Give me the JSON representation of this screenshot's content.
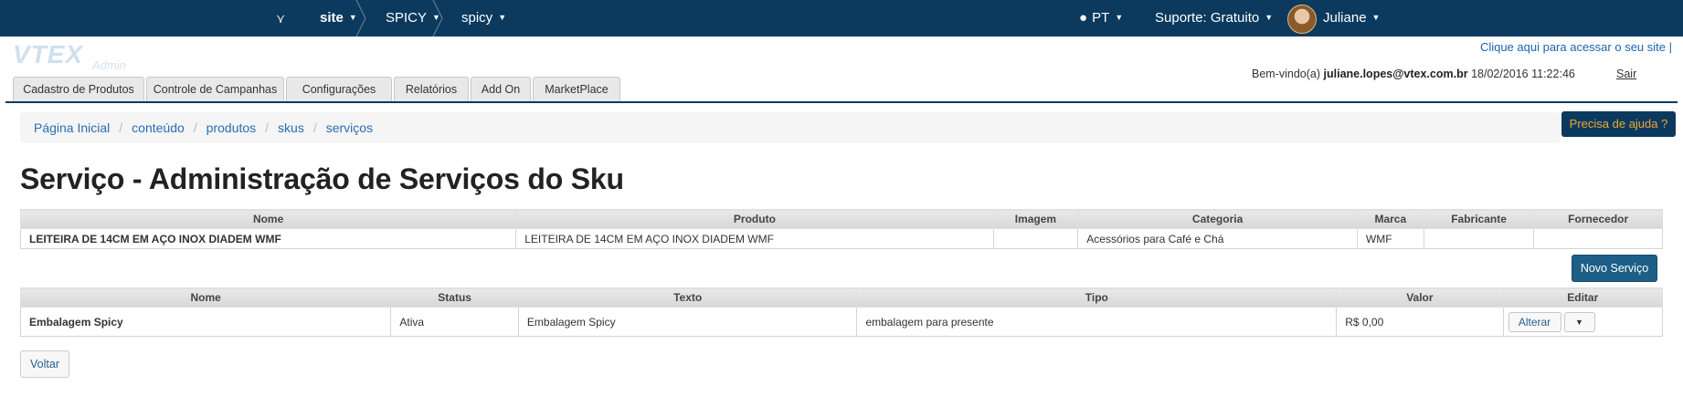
{
  "topbar": {
    "site_label": "site",
    "account_label": "SPICY",
    "store_label": "spicy",
    "language_label": "PT",
    "support_label": "Suporte: Gratuito",
    "user_name": "Juliane"
  },
  "header": {
    "logo_text": "VTEX",
    "logo_sub": "Admin",
    "access_link": "Clique aqui para acessar o seu site |",
    "welcome_prefix": "Bem-vindo(a)",
    "welcome_email": "juliane.lopes@vtex.com.br",
    "welcome_datetime": "18/02/2016 11:22:46",
    "logout_label": "Sair"
  },
  "tabs": [
    "Cadastro de Produtos",
    "Controle de Campanhas",
    "Configurações",
    "Relatórios",
    "Add On",
    "MarketPlace"
  ],
  "breadcrumb": [
    "Página Inicial",
    "conteúdo",
    "produtos",
    "skus",
    "serviços"
  ],
  "help_button": "Precisa de ajuda ?",
  "page_title": "Serviço - Administração de Serviços do Sku",
  "product_table": {
    "headers": [
      "Nome",
      "Produto",
      "Imagem",
      "Categoria",
      "Marca",
      "Fabricante",
      "Fornecedor"
    ],
    "row": [
      "LEITEIRA DE 14CM EM AÇO INOX DIADEM WMF",
      "LEITEIRA DE 14CM EM AÇO INOX DIADEM WMF",
      "",
      "Acessórios para Café e Chá",
      "WMF",
      "",
      ""
    ]
  },
  "new_service_button": "Novo Serviço",
  "services_table": {
    "headers": [
      "Nome",
      "Status",
      "Texto",
      "Tipo",
      "Valor",
      "Editar"
    ],
    "row": [
      "Embalagem Spicy",
      "Ativa",
      "Embalagem Spicy",
      "embalagem para presente",
      "R$ 0,00"
    ],
    "edit_label": "Alterar",
    "dropdown_glyph": "▼"
  },
  "back_button": "Voltar",
  "colors": {
    "topbar": "#0b3a5e",
    "link": "#2a6db3",
    "help_text": "#f0a632",
    "primary_button": "#1d5f86"
  }
}
